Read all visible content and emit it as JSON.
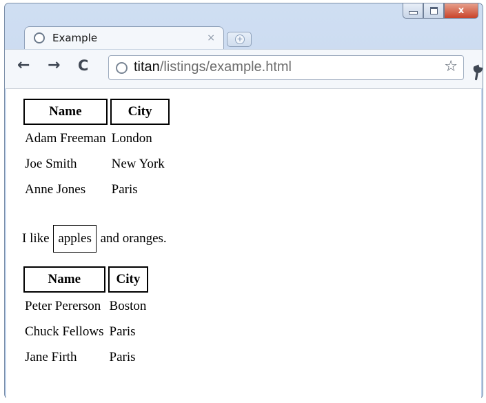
{
  "window": {
    "tab_title": "Example",
    "tab_close": "×",
    "new_tab": "+",
    "caption_close": "x"
  },
  "toolbar": {
    "back": "←",
    "forward": "→",
    "reload": "C",
    "url_host": "titan",
    "url_path": "/listings/example.html",
    "star": "☆",
    "wrench": "🔧"
  },
  "content": {
    "table1": {
      "headers": [
        "Name",
        "City"
      ],
      "rows": [
        [
          "Adam Freeman",
          "London"
        ],
        [
          "Joe Smith",
          "New York"
        ],
        [
          "Anne Jones",
          "Paris"
        ]
      ]
    },
    "paragraph": {
      "before": "I like",
      "boxed": "apples",
      "after": "and oranges."
    },
    "table2": {
      "headers": [
        "Name",
        "City"
      ],
      "rows": [
        [
          "Peter Pererson",
          "Boston"
        ],
        [
          "Chuck Fellows",
          "Paris"
        ],
        [
          "Jane Firth",
          "Paris"
        ]
      ]
    }
  }
}
